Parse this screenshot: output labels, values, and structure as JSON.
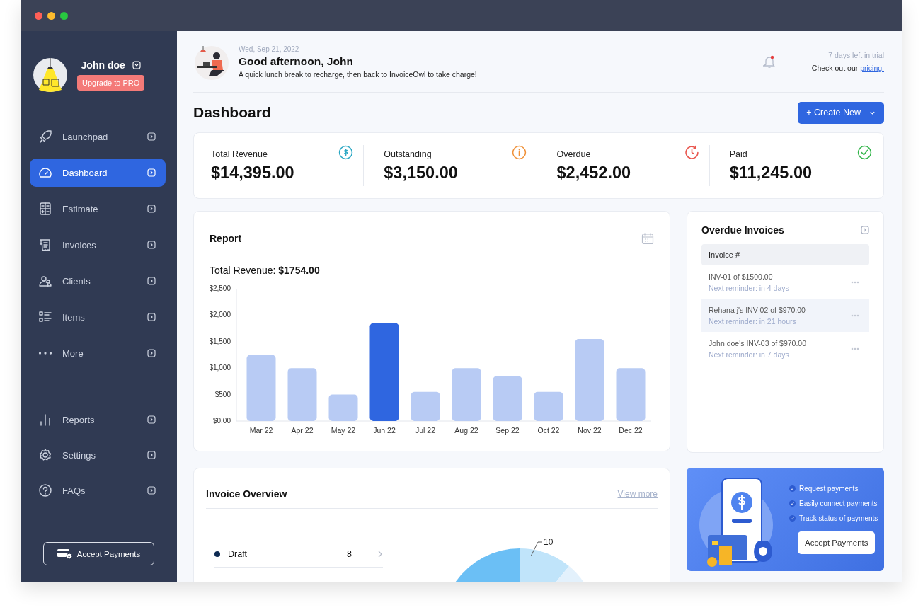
{
  "window": {
    "controls": [
      {
        "color": "#ff5f57"
      },
      {
        "color": "#febc2e"
      },
      {
        "color": "#28c840"
      }
    ]
  },
  "user": {
    "name": "John doe",
    "upgrade_label": "Upgrade to PRO"
  },
  "sidebar": {
    "items": [
      {
        "label": "Launchpad",
        "kind": "rocket",
        "selected": false
      },
      {
        "label": "Dashboard",
        "kind": "gauge",
        "selected": true
      },
      {
        "label": "Estimate",
        "kind": "calculator",
        "selected": false
      },
      {
        "label": "Invoices",
        "kind": "receipt",
        "selected": false
      },
      {
        "label": "Clients",
        "kind": "people",
        "selected": false
      },
      {
        "label": "Items",
        "kind": "list",
        "selected": false
      },
      {
        "label": "More",
        "kind": "dots",
        "selected": false
      }
    ],
    "bottom_items": [
      {
        "label": "Reports",
        "kind": "bars",
        "selected": false
      },
      {
        "label": "Settings",
        "kind": "gear",
        "selected": false
      },
      {
        "label": "FAQs",
        "kind": "help",
        "selected": false
      }
    ],
    "accept_button": "Accept Payments"
  },
  "header": {
    "date": "Wed,  Sep 21, 2022",
    "greeting": "Good afternoon, John",
    "message": "A quick lunch break to recharge, then back to InvoiceOwl to take charge!",
    "unread_notifications": true,
    "trial_text": "7 days left in trial",
    "trial_prefix": "Check out our",
    "trial_link": "pricing."
  },
  "page_title": "Dashboard",
  "create_button": "+ Create New",
  "stats": [
    {
      "label": "Total Revenue",
      "value": "$14,395.00",
      "kind": "dollar"
    },
    {
      "label": "Outstanding",
      "value": "$3,150.00",
      "kind": "info"
    },
    {
      "label": "Overdue",
      "value": "$2,452.00",
      "kind": "clock"
    },
    {
      "label": "Paid",
      "value": "$11,245.00",
      "kind": "check"
    }
  ],
  "report": {
    "title": "Report",
    "total": "Total Revenue: **$1754.00**",
    "bars": [
      {
        "selected": false
      },
      {
        "selected": false
      },
      {
        "selected": false
      },
      {
        "selected": true
      },
      {
        "selected": false
      },
      {
        "selected": false
      },
      {
        "selected": false
      },
      {
        "selected": false
      },
      {
        "selected": false
      },
      {
        "selected": false
      }
    ],
    "chart_data": {
      "type": "bar",
      "categories": [
        "Mar 22",
        "Apr 22",
        "May 22",
        "Jun 22",
        "Jul 22",
        "Aug 22",
        "Sep 22",
        "Oct 22",
        "Nov 22",
        "Dec 22"
      ],
      "values": [
        1250,
        1000,
        500,
        1850,
        550,
        1000,
        850,
        550,
        1550,
        1000
      ],
      "ylim": [
        0,
        2500
      ],
      "yticks": [
        {
          "value": 0,
          "label": "$0.00"
        },
        {
          "value": 500,
          "label": "$500"
        },
        {
          "value": 1000,
          "label": "$1,000"
        },
        {
          "value": 1500,
          "label": "$1,500"
        },
        {
          "value": 2000,
          "label": "$2,000"
        },
        {
          "value": 2500,
          "label": "$2,500"
        }
      ]
    }
  },
  "overdue": {
    "title": "Overdue Invoices",
    "column": "Invoice #",
    "rows": [
      {
        "title": "INV-01 of $1500.00",
        "reminder": "Next reminder: in 4 days",
        "selected": false
      },
      {
        "title": "Rehana j's INV-02 of $970.00",
        "reminder": "Next reminder: in 21 hours",
        "selected": true
      },
      {
        "title": "John doe's INV-03 of $970.00",
        "reminder": "Next reminder: in 7 days",
        "selected": false
      }
    ]
  },
  "overview": {
    "title": "Invoice Overview",
    "link": "View more",
    "legend": [
      {
        "label": "Draft",
        "count": "8",
        "color": "#0d2a52"
      }
    ],
    "pie_label": "10"
  },
  "promo": {
    "features": [
      "Request payments",
      "Easily connect payments",
      "Track status of payments"
    ],
    "button": "Accept Payments"
  }
}
